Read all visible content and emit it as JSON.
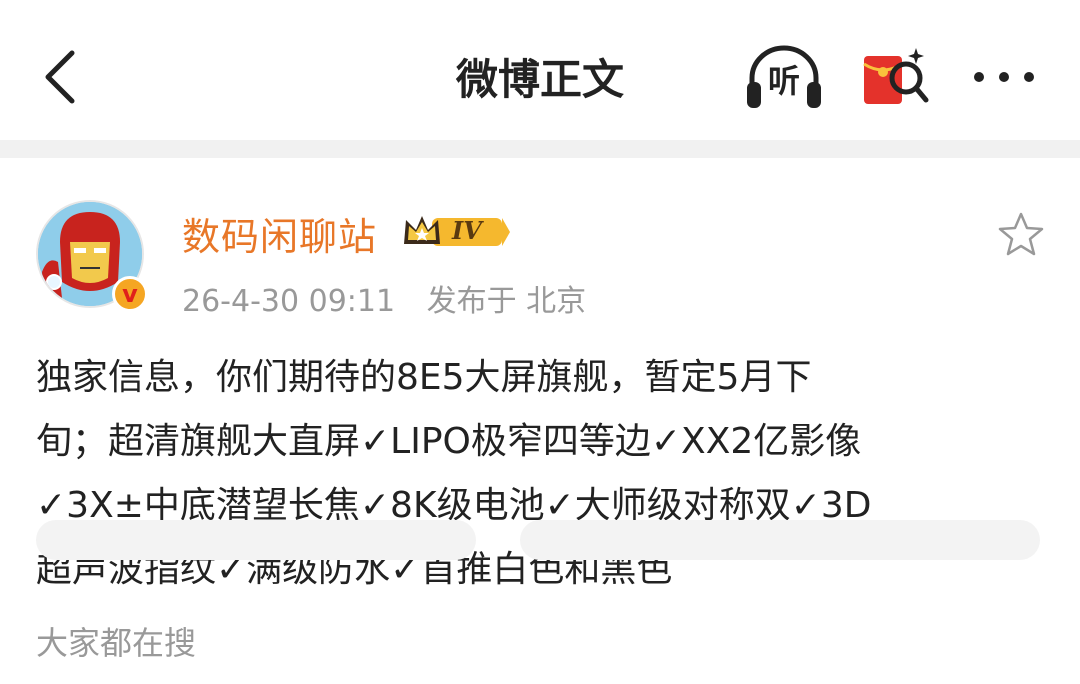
{
  "header": {
    "title": "微博正文",
    "listen_label": "听"
  },
  "post": {
    "author": "数码闲聊站",
    "level": "IV",
    "verified_mark": "v",
    "time": "26-4-30 09:11",
    "location_prefix": "发布于",
    "location": "北京",
    "content_lines": [
      "独家信息，你们期待的8E5大屏旗舰，暂定5月下",
      "旬；超清旗舰大直屏✓LIPO极窄四等边✓XX2亿影像",
      "✓3X±中底潜望长焦✓8K级电池✓大师级对称双✓3D",
      "超声波指纹✓满级防水✓首推白色和黑色"
    ]
  },
  "search": {
    "label": "大家都在搜"
  },
  "colors": {
    "author": "#e87728",
    "meta": "#999999",
    "separator": "#f1f1f1",
    "redpacket": "#e4322b",
    "badge_gold": "#f5b82e"
  },
  "icons": [
    "back-arrow-icon",
    "headphones-icon",
    "red-packet-search-icon",
    "more-dots-icon",
    "star-outline-icon",
    "crown-icon",
    "verified-v-icon"
  ]
}
